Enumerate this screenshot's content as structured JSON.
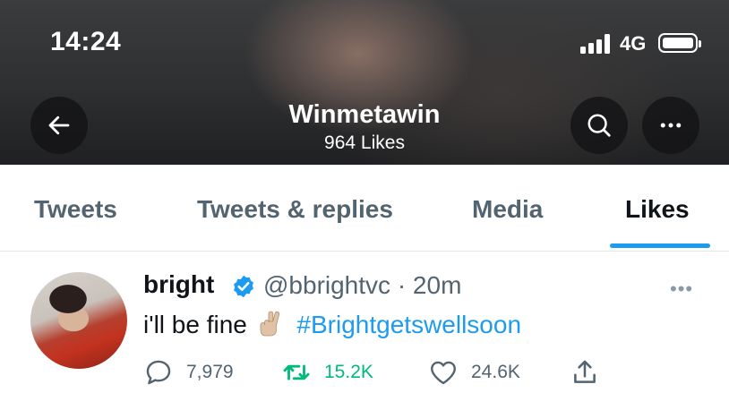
{
  "status_bar": {
    "time": "14:24",
    "network": "4G",
    "signal_bars": 4,
    "battery_level": 1.0
  },
  "header": {
    "title": "Winmetawin",
    "subtitle": "964 Likes"
  },
  "tabs": [
    {
      "label": "Tweets",
      "active": false
    },
    {
      "label": "Tweets & replies",
      "active": false
    },
    {
      "label": "Media",
      "active": false
    },
    {
      "label": "Likes",
      "active": true
    }
  ],
  "tweet": {
    "display_name": "bright",
    "verified": true,
    "handle_time": "@bbrightvc · 20m",
    "text": "i'll be fine",
    "emoji": "crossed-fingers-emoji",
    "hashtag": "#Brightgetswellsoon",
    "replies": "7,979",
    "retweets": "15.2K",
    "likes": "24.6K"
  },
  "colors": {
    "accent": "#1d9bf0",
    "retweet": "#00ba7c",
    "muted": "#536471",
    "text": "#0f1419"
  },
  "icons": [
    "back-arrow-icon",
    "search-icon",
    "more-icon",
    "verified-badge-icon",
    "reply-icon",
    "retweet-icon",
    "like-icon",
    "share-icon"
  ]
}
